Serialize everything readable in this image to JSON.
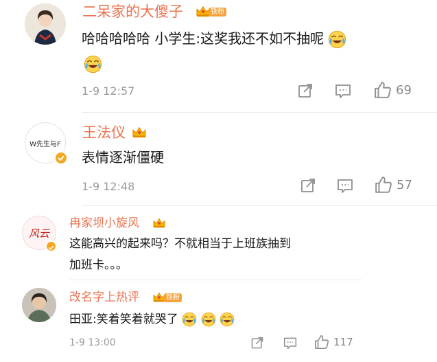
{
  "comments": [
    {
      "username": "二呆家的大傻子",
      "fan_badge": "铁粉",
      "text": "哈哈哈哈哈 小学生:这奖我还不如不抽呢",
      "time": "1-9 12:57",
      "likes": "69"
    },
    {
      "username": "王法仪",
      "avatar_text": "W先生与F",
      "text": "表情逐渐僵硬",
      "time": "1-9 12:48",
      "likes": "57"
    },
    {
      "username": "冉家坝小旋风",
      "avatar_text": "风云",
      "text_line1": "这能高兴的起来吗？不就相当于上班族抽到",
      "text_line2": "加班卡。。。",
      "text": "这能高兴的起来吗？不就相当于上班族抽到加班卡。。。"
    },
    {
      "username": "改名字上热评",
      "fan_badge": "铁粉",
      "text": "田亚:笑着笑着就哭了",
      "time": "1-9 13:00",
      "likes": "117"
    }
  ],
  "icons": {
    "share": "share-icon",
    "comment": "comment-icon",
    "like": "thumbs-up-icon",
    "crown": "crown-icon",
    "emoji": "laugh-cry-emoji",
    "verified": "verified-badge-icon"
  },
  "colors": {
    "username": "#eb7350",
    "badge": "#f7a33b",
    "text": "#1a1a1a",
    "meta": "#9a9a9a"
  }
}
